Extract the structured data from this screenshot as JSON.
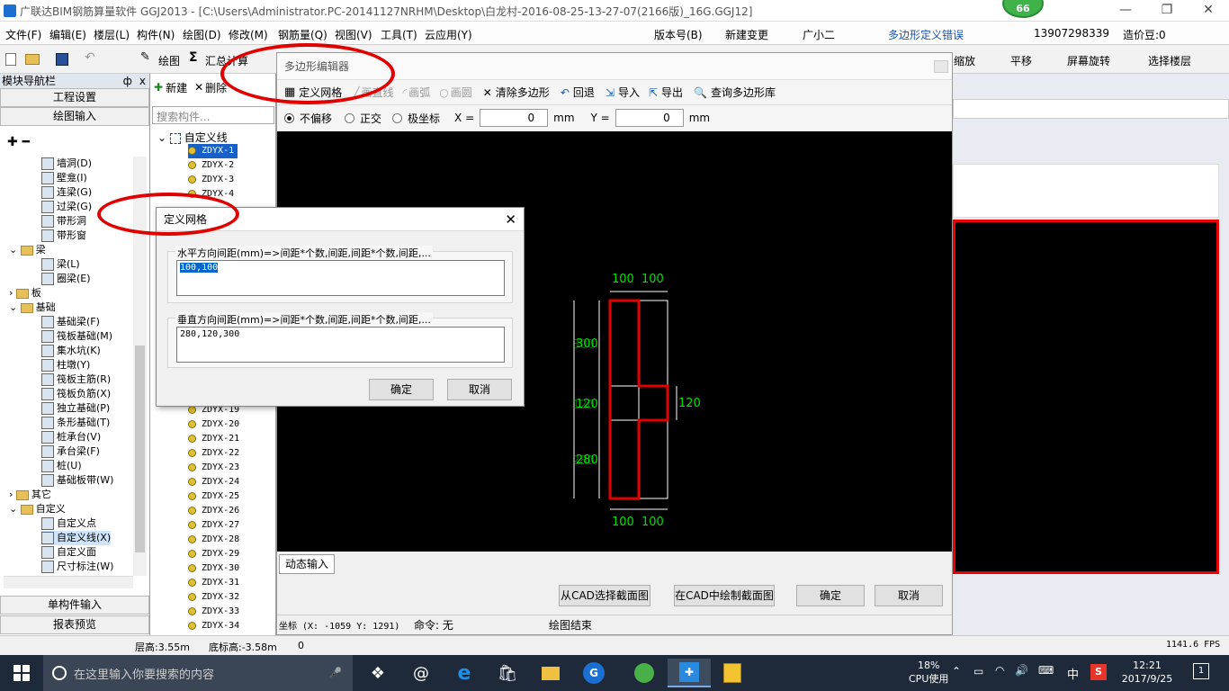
{
  "window": {
    "title": "广联达BIM钢筋算量软件 GGJ2013 - [C:\\Users\\Administrator.PC-20141127NRHM\\Desktop\\白龙村-2016-08-25-13-27-07(2166版)_16G.GGJ12]",
    "badge": "66"
  },
  "menu": {
    "items": [
      "文件(F)",
      "编辑(E)",
      "楼层(L)",
      "构件(N)",
      "绘图(D)",
      "修改(M)",
      "钢筋量(Q)",
      "视图(V)",
      "工具(T)",
      "云应用(Y)"
    ],
    "ime": [
      "中",
      "°,"
    ],
    "right": [
      "版本号(B)",
      "新建变更",
      "广小二"
    ],
    "error": "多边形定义错误",
    "phone": "13907298339",
    "price": "造价豆:0"
  },
  "toolbar2": {
    "draw": "绘图",
    "summary": "汇总计算",
    "zoom": "缩放",
    "pan": "平移",
    "rotate": "屏幕旋转",
    "floor": "选择楼层"
  },
  "leftnav": {
    "title": "模块导航栏",
    "pin": "ф",
    "close": "x",
    "btn_project": "工程设置",
    "btn_draw": "绘图输入",
    "btn_single": "单构件输入",
    "btn_report": "报表预览",
    "tree": [
      "墙洞(D)",
      "壁龛(I)",
      "连梁(G)",
      "过梁(G)",
      "带形洞",
      "带形窗",
      "梁",
      "梁(L)",
      "圈梁(E)",
      "板",
      "基础",
      "基础梁(F)",
      "筏板基础(M)",
      "集水坑(K)",
      "柱墩(Y)",
      "筏板主筋(R)",
      "筏板负筋(X)",
      "独立基础(P)",
      "条形基础(T)",
      "桩承台(V)",
      "承台梁(F)",
      "桩(U)",
      "基础板带(W)",
      "其它",
      "自定义",
      "自定义点",
      "自定义线(X)",
      "自定义面",
      "尺寸标注(W)"
    ]
  },
  "complist": {
    "new": "新建",
    "delete": "删除",
    "search_placeholder": "搜索构件...",
    "root": "自定义线",
    "items": [
      "ZDYX-1",
      "ZDYX-2",
      "ZDYX-3",
      "ZDYX-4",
      "ZDYX-19",
      "ZDYX-20",
      "ZDYX-21",
      "ZDYX-22",
      "ZDYX-23",
      "ZDYX-24",
      "ZDYX-25",
      "ZDYX-26",
      "ZDYX-27",
      "ZDYX-28",
      "ZDYX-29",
      "ZDYX-30",
      "ZDYX-31",
      "ZDYX-32",
      "ZDYX-33",
      "ZDYX-34"
    ]
  },
  "poly": {
    "title": "多边形编辑器",
    "define_grid": "定义网格",
    "line": "画直线",
    "arc": "画弧",
    "circle": "画圆",
    "clear": "清除多边形",
    "undo": "回退",
    "import": "导入",
    "export": "导出",
    "query": "查询多边形库",
    "no_offset": "不偏移",
    "ortho": "正交",
    "polar": "极坐标",
    "x_label": "X =",
    "x_val": "0",
    "y_label": "Y =",
    "y_val": "0",
    "unit": "mm",
    "dim_top": [
      "100",
      "100"
    ],
    "dim_bottom": [
      "100",
      "100"
    ],
    "dim_left": [
      "300",
      "120",
      "280"
    ],
    "dim_left_ghost": [
      "300",
      "120",
      "280"
    ],
    "dim_right": "120",
    "dyn_input": "动态输入",
    "from_cad": "从CAD选择截面图",
    "in_cad": "在CAD中绘制截面图",
    "ok": "确定",
    "cancel": "取消",
    "coord": "坐标 (X: -1059 Y: 1291)",
    "cmd": "命令: 无",
    "end": "绘图结束"
  },
  "grid_dialog": {
    "title": "定义网格",
    "h_label": "水平方向间距(mm)=>间距*个数,间距,间距*个数,间距,...",
    "h_value": "100,100",
    "v_label": "垂直方向间距(mm)=>间距*个数,间距,间距*个数,间距,...",
    "v_value": "280,120,300",
    "ok": "确定",
    "cancel": "取消"
  },
  "status": {
    "floor_h": "层高:3.55m",
    "bottom_h": "底标高:-3.58m",
    "zero": "0",
    "fps": "1141.6 FPS"
  },
  "taskbar": {
    "search": "在这里输入你要搜索的内容",
    "cpu_pct": "18%",
    "cpu_label": "CPU使用",
    "lang": "中",
    "time": "12:21",
    "date": "2017/9/25",
    "notif": "1"
  },
  "colors": {
    "accent": "#0078d7",
    "dim": "#00e000",
    "poly": "#e00000",
    "taskbar": "#1e2a3a"
  }
}
